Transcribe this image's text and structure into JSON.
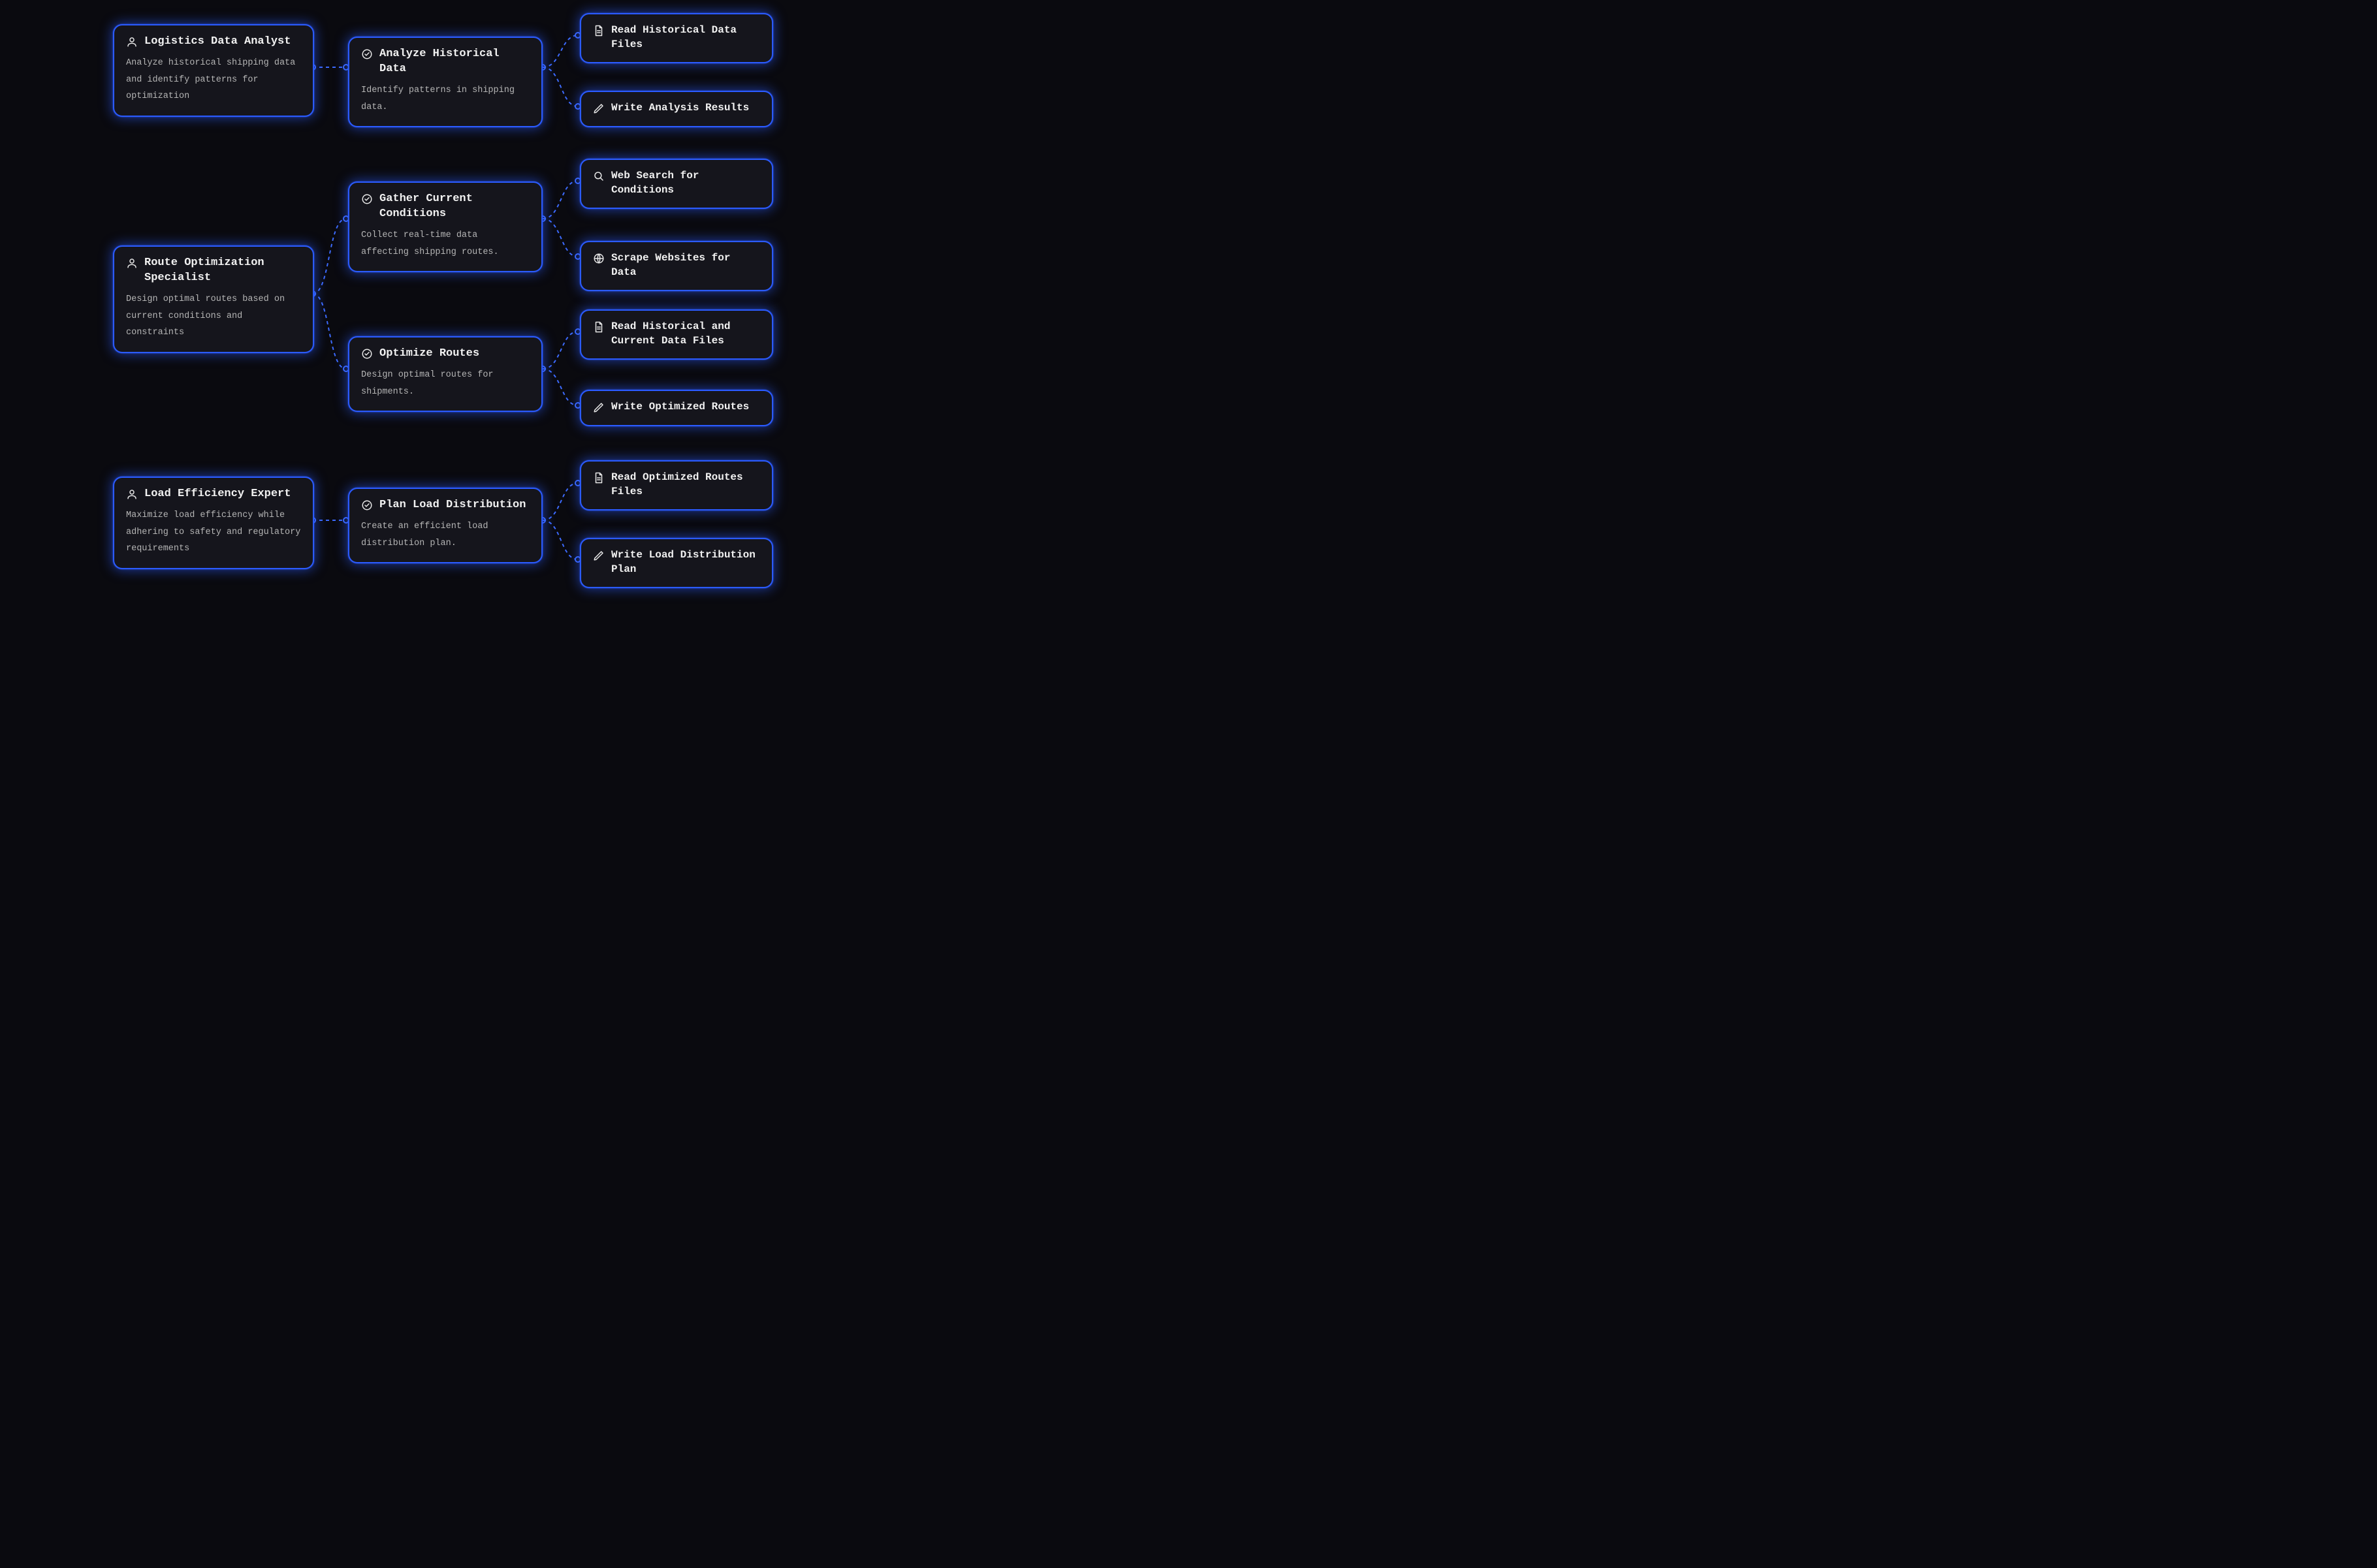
{
  "agents": [
    {
      "title": "Logistics Data Analyst",
      "desc": "Analyze historical shipping data and identify patterns for optimization"
    },
    {
      "title": "Route Optimization Specialist",
      "desc": "Design optimal routes based on current conditions and constraints"
    },
    {
      "title": "Load Efficiency Expert",
      "desc": "Maximize load efficiency while adhering to safety and regulatory requirements"
    }
  ],
  "tasks": [
    {
      "title": "Analyze Historical Data",
      "desc": "Identify patterns in shipping data."
    },
    {
      "title": "Gather Current Conditions",
      "desc": "Collect real-time data affecting shipping routes."
    },
    {
      "title": "Optimize Routes",
      "desc": "Design optimal routes for shipments."
    },
    {
      "title": "Plan Load Distribution",
      "desc": "Create an efficient load distribution plan."
    }
  ],
  "actions": [
    {
      "title": "Read Historical Data Files"
    },
    {
      "title": "Write Analysis Results"
    },
    {
      "title": "Web Search for Conditions"
    },
    {
      "title": "Scrape Websites for Data"
    },
    {
      "title": "Read Historical and Current Data Files"
    },
    {
      "title": "Write Optimized Routes"
    },
    {
      "title": "Read Optimized Routes Files"
    },
    {
      "title": "Write Load Distribution Plan"
    }
  ]
}
